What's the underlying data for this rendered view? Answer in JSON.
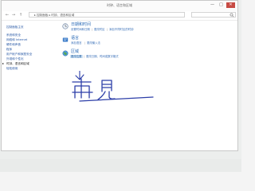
{
  "window": {
    "title": "时钟、语言和区域",
    "controls": [
      "—",
      "□",
      "✕"
    ]
  },
  "address": {
    "path": "▸ 控制面板 ▸ 时钟、语言和区域",
    "back": "←",
    "forward": "→",
    "up": "↑",
    "search_icon": "search-icon"
  },
  "sidebar": {
    "items": [
      {
        "label": "控制面板主页"
      },
      {
        "label": "系统和安全"
      },
      {
        "label": "网络和 Internet"
      },
      {
        "label": "硬件和声音"
      },
      {
        "label": "程序"
      },
      {
        "label": "用户帐户和家庭安全"
      },
      {
        "label": "外观和个性化"
      },
      {
        "label": "时钟、语言和区域"
      },
      {
        "label": "轻松使用"
      }
    ]
  },
  "categories": [
    {
      "icon": "clock-icon",
      "title": "日期和时间",
      "links": [
        "设置时间和日期",
        "更改时区",
        "添加不同时区的时钟"
      ]
    },
    {
      "icon": "language-icon",
      "title": "语言",
      "links": [
        "添加语言",
        "更改输入法"
      ]
    },
    {
      "icon": "region-globe-icon",
      "title": "区域",
      "links": [
        "更改位置",
        "更改日期、时间或数字格式"
      ]
    }
  ],
  "annotation": {
    "handwriting": "再見",
    "arrow": "down-arrow"
  },
  "colors": {
    "link": "#2a6ab6",
    "highlight": "#cfe3f6",
    "ink": "#2c3ea8",
    "close": "#c74b44"
  }
}
